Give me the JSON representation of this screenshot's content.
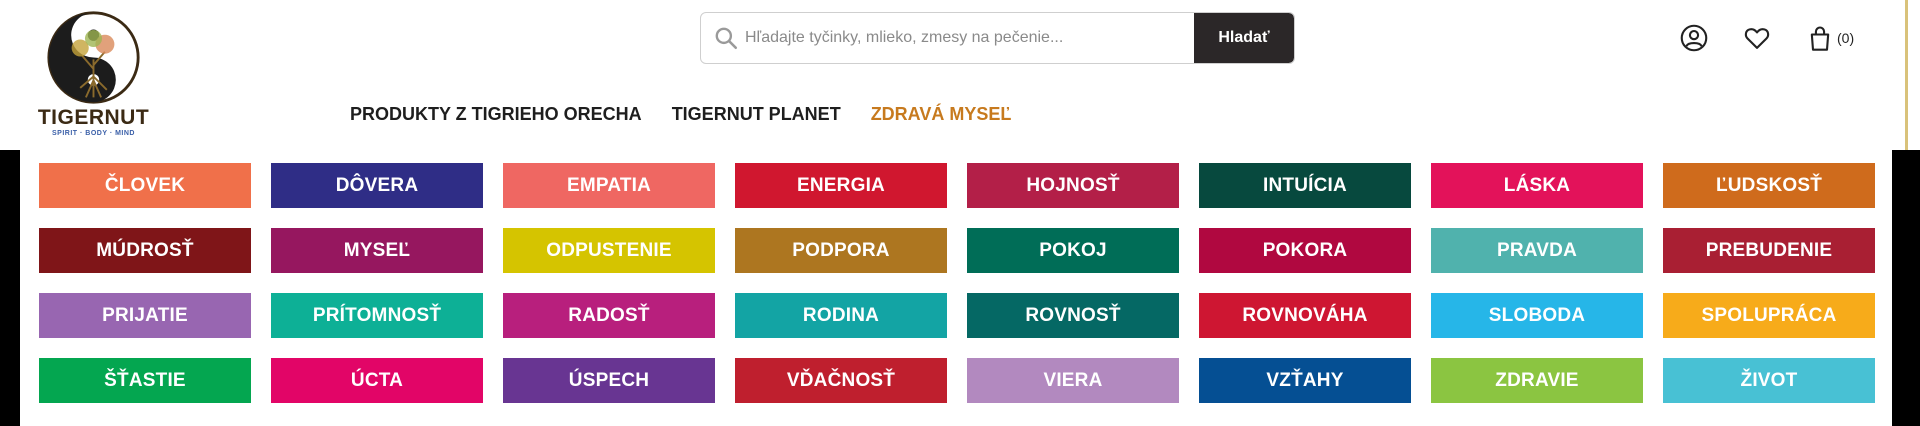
{
  "brand": {
    "name": "TIGERNUT",
    "tagline": "SPIRIT · BODY · MIND"
  },
  "search": {
    "placeholder": "Hľadajte tyčinky, mlieko, zmesy na pečenie...",
    "button_label": "Hladať"
  },
  "header_icons": {
    "account": "user-icon",
    "wishlist": "heart-icon",
    "cart": "bag-icon",
    "cart_count": "(0)"
  },
  "nav": {
    "items": [
      {
        "label": "PRODUKTY Z TIGRIEHO ORECHA",
        "active": false
      },
      {
        "label": "TIGERNUT PLANET",
        "active": false
      },
      {
        "label": "ZDRAVÁ MYSEĽ",
        "active": true
      }
    ],
    "active_color": "#c77a1e"
  },
  "categories": [
    {
      "label": "ČLOVEK",
      "color": "#f0704a"
    },
    {
      "label": "DÔVERA",
      "color": "#2f2d86"
    },
    {
      "label": "EMPATIA",
      "color": "#ef6762"
    },
    {
      "label": "ENERGIA",
      "color": "#d0172f"
    },
    {
      "label": "HOJNOSŤ",
      "color": "#b31f48"
    },
    {
      "label": "INTUÍCIA",
      "color": "#07493e"
    },
    {
      "label": "LÁSKA",
      "color": "#e3125a"
    },
    {
      "label": "ĽUDSKOSŤ",
      "color": "#cf6b1c"
    },
    {
      "label": "MÚDROSŤ",
      "color": "#7f1518"
    },
    {
      "label": "MYSEĽ",
      "color": "#96175f"
    },
    {
      "label": "ODPUSTENIE",
      "color": "#d5c400"
    },
    {
      "label": "PODPORA",
      "color": "#ad7620"
    },
    {
      "label": "POKOJ",
      "color": "#006d57"
    },
    {
      "label": "POKORA",
      "color": "#b00840"
    },
    {
      "label": "PRAVDA",
      "color": "#50b2ad"
    },
    {
      "label": "PREBUDENIE",
      "color": "#a91f33"
    },
    {
      "label": "PRIJATIE",
      "color": "#9866b1"
    },
    {
      "label": "PRÍTOMNOSŤ",
      "color": "#0db096"
    },
    {
      "label": "RADOSŤ",
      "color": "#b81f7d"
    },
    {
      "label": "RODINA",
      "color": "#13a4a4"
    },
    {
      "label": "ROVNOSŤ",
      "color": "#056864"
    },
    {
      "label": "ROVNOVÁHA",
      "color": "#ce1632"
    },
    {
      "label": "SLOBODA",
      "color": "#26b6e8"
    },
    {
      "label": "SPOLUPRÁCA",
      "color": "#f7ab1a"
    },
    {
      "label": "ŠŤASTIE",
      "color": "#04a650"
    },
    {
      "label": "ÚCTA",
      "color": "#e20567"
    },
    {
      "label": "ÚSPECH",
      "color": "#683592"
    },
    {
      "label": "VĎAČNOSŤ",
      "color": "#bf1f2e"
    },
    {
      "label": "VIERA",
      "color": "#b289bf"
    },
    {
      "label": "VZŤAHY",
      "color": "#054f93"
    },
    {
      "label": "ZDRAVIE",
      "color": "#8bc541"
    },
    {
      "label": "ŽIVOT",
      "color": "#48c1d4"
    }
  ]
}
